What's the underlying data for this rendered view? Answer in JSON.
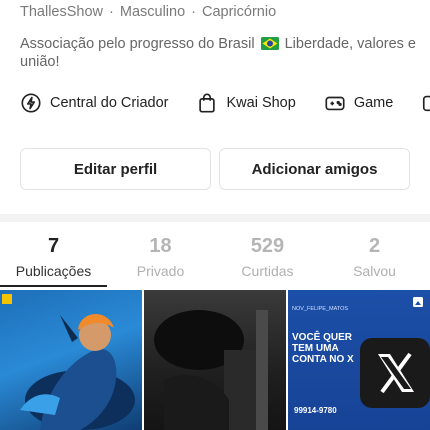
{
  "profile": {
    "username": "ThallesShow",
    "gender": "Masculino",
    "sign": "Capricórnio",
    "bio_prefix": "Associação pelo progresso do Brasil",
    "bio_suffix": "Liberdade, valores e união!"
  },
  "shortcuts": [
    {
      "label": "Central do Criador",
      "icon": "lightning-icon"
    },
    {
      "label": "Kwai Shop",
      "icon": "shopping-bag-icon"
    },
    {
      "label": "Game",
      "icon": "gamepad-icon"
    }
  ],
  "buttons": {
    "edit": "Editar perfil",
    "add": "Adicionar amigos"
  },
  "tabs": [
    {
      "count": "7",
      "label": "Publicações",
      "active": true
    },
    {
      "count": "18",
      "label": "Privado"
    },
    {
      "count": "529",
      "label": "Curtidas"
    },
    {
      "count": "2",
      "label": "Salvou"
    }
  ],
  "grid": {
    "post3": {
      "handle": "NOV_FELIPE_MATOS",
      "headline": "VOCÊ QUER TEM UMA CONTA NO X",
      "phone": "99914-9780"
    }
  },
  "colors": {
    "accent": "#222222",
    "muted": "#b0b0b0",
    "post_blue": "#1c4fa8"
  }
}
